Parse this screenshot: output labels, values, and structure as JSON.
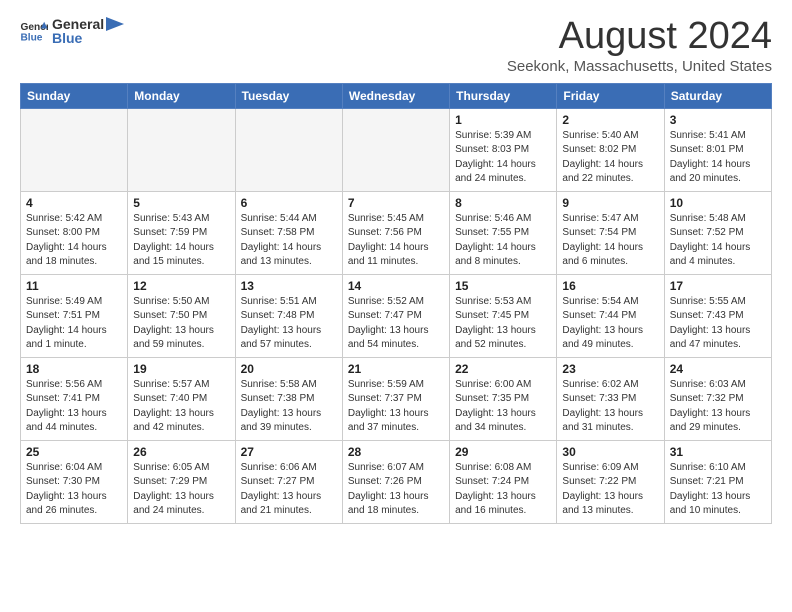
{
  "header": {
    "logo_general": "General",
    "logo_blue": "Blue",
    "month_title": "August 2024",
    "location": "Seekonk, Massachusetts, United States"
  },
  "days_of_week": [
    "Sunday",
    "Monday",
    "Tuesday",
    "Wednesday",
    "Thursday",
    "Friday",
    "Saturday"
  ],
  "weeks": [
    [
      {
        "date": "",
        "info": ""
      },
      {
        "date": "",
        "info": ""
      },
      {
        "date": "",
        "info": ""
      },
      {
        "date": "",
        "info": ""
      },
      {
        "date": "1",
        "info": "Sunrise: 5:39 AM\nSunset: 8:03 PM\nDaylight: 14 hours\nand 24 minutes."
      },
      {
        "date": "2",
        "info": "Sunrise: 5:40 AM\nSunset: 8:02 PM\nDaylight: 14 hours\nand 22 minutes."
      },
      {
        "date": "3",
        "info": "Sunrise: 5:41 AM\nSunset: 8:01 PM\nDaylight: 14 hours\nand 20 minutes."
      }
    ],
    [
      {
        "date": "4",
        "info": "Sunrise: 5:42 AM\nSunset: 8:00 PM\nDaylight: 14 hours\nand 18 minutes."
      },
      {
        "date": "5",
        "info": "Sunrise: 5:43 AM\nSunset: 7:59 PM\nDaylight: 14 hours\nand 15 minutes."
      },
      {
        "date": "6",
        "info": "Sunrise: 5:44 AM\nSunset: 7:58 PM\nDaylight: 14 hours\nand 13 minutes."
      },
      {
        "date": "7",
        "info": "Sunrise: 5:45 AM\nSunset: 7:56 PM\nDaylight: 14 hours\nand 11 minutes."
      },
      {
        "date": "8",
        "info": "Sunrise: 5:46 AM\nSunset: 7:55 PM\nDaylight: 14 hours\nand 8 minutes."
      },
      {
        "date": "9",
        "info": "Sunrise: 5:47 AM\nSunset: 7:54 PM\nDaylight: 14 hours\nand 6 minutes."
      },
      {
        "date": "10",
        "info": "Sunrise: 5:48 AM\nSunset: 7:52 PM\nDaylight: 14 hours\nand 4 minutes."
      }
    ],
    [
      {
        "date": "11",
        "info": "Sunrise: 5:49 AM\nSunset: 7:51 PM\nDaylight: 14 hours\nand 1 minute."
      },
      {
        "date": "12",
        "info": "Sunrise: 5:50 AM\nSunset: 7:50 PM\nDaylight: 13 hours\nand 59 minutes."
      },
      {
        "date": "13",
        "info": "Sunrise: 5:51 AM\nSunset: 7:48 PM\nDaylight: 13 hours\nand 57 minutes."
      },
      {
        "date": "14",
        "info": "Sunrise: 5:52 AM\nSunset: 7:47 PM\nDaylight: 13 hours\nand 54 minutes."
      },
      {
        "date": "15",
        "info": "Sunrise: 5:53 AM\nSunset: 7:45 PM\nDaylight: 13 hours\nand 52 minutes."
      },
      {
        "date": "16",
        "info": "Sunrise: 5:54 AM\nSunset: 7:44 PM\nDaylight: 13 hours\nand 49 minutes."
      },
      {
        "date": "17",
        "info": "Sunrise: 5:55 AM\nSunset: 7:43 PM\nDaylight: 13 hours\nand 47 minutes."
      }
    ],
    [
      {
        "date": "18",
        "info": "Sunrise: 5:56 AM\nSunset: 7:41 PM\nDaylight: 13 hours\nand 44 minutes."
      },
      {
        "date": "19",
        "info": "Sunrise: 5:57 AM\nSunset: 7:40 PM\nDaylight: 13 hours\nand 42 minutes."
      },
      {
        "date": "20",
        "info": "Sunrise: 5:58 AM\nSunset: 7:38 PM\nDaylight: 13 hours\nand 39 minutes."
      },
      {
        "date": "21",
        "info": "Sunrise: 5:59 AM\nSunset: 7:37 PM\nDaylight: 13 hours\nand 37 minutes."
      },
      {
        "date": "22",
        "info": "Sunrise: 6:00 AM\nSunset: 7:35 PM\nDaylight: 13 hours\nand 34 minutes."
      },
      {
        "date": "23",
        "info": "Sunrise: 6:02 AM\nSunset: 7:33 PM\nDaylight: 13 hours\nand 31 minutes."
      },
      {
        "date": "24",
        "info": "Sunrise: 6:03 AM\nSunset: 7:32 PM\nDaylight: 13 hours\nand 29 minutes."
      }
    ],
    [
      {
        "date": "25",
        "info": "Sunrise: 6:04 AM\nSunset: 7:30 PM\nDaylight: 13 hours\nand 26 minutes."
      },
      {
        "date": "26",
        "info": "Sunrise: 6:05 AM\nSunset: 7:29 PM\nDaylight: 13 hours\nand 24 minutes."
      },
      {
        "date": "27",
        "info": "Sunrise: 6:06 AM\nSunset: 7:27 PM\nDaylight: 13 hours\nand 21 minutes."
      },
      {
        "date": "28",
        "info": "Sunrise: 6:07 AM\nSunset: 7:26 PM\nDaylight: 13 hours\nand 18 minutes."
      },
      {
        "date": "29",
        "info": "Sunrise: 6:08 AM\nSunset: 7:24 PM\nDaylight: 13 hours\nand 16 minutes."
      },
      {
        "date": "30",
        "info": "Sunrise: 6:09 AM\nSunset: 7:22 PM\nDaylight: 13 hours\nand 13 minutes."
      },
      {
        "date": "31",
        "info": "Sunrise: 6:10 AM\nSunset: 7:21 PM\nDaylight: 13 hours\nand 10 minutes."
      }
    ]
  ]
}
